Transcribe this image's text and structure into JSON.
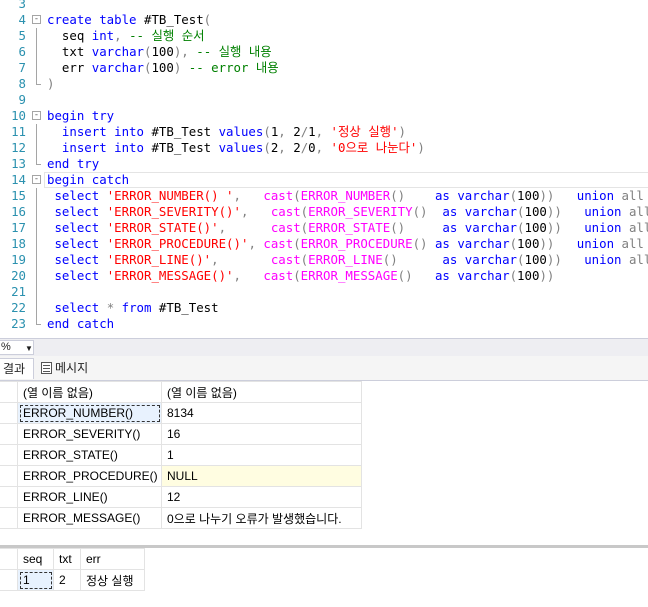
{
  "editor": {
    "lines": [
      {
        "n": "3",
        "fold": "",
        "guide": "",
        "tokens": []
      },
      {
        "n": "4",
        "fold": "-",
        "guide": "",
        "tokens": [
          {
            "c": "kw",
            "t": "create table "
          },
          {
            "c": "tx",
            "t": "#TB_Test"
          },
          {
            "c": "op",
            "t": "("
          }
        ]
      },
      {
        "n": "5",
        "fold": "",
        "guide": "v",
        "tokens": [
          {
            "c": "tx",
            "t": "  seq "
          },
          {
            "c": "kw",
            "t": "int"
          },
          {
            "c": "op",
            "t": ", "
          },
          {
            "c": "cm",
            "t": "-- 실행 순서"
          }
        ]
      },
      {
        "n": "6",
        "fold": "",
        "guide": "v",
        "tokens": [
          {
            "c": "tx",
            "t": "  txt "
          },
          {
            "c": "kw",
            "t": "varchar"
          },
          {
            "c": "op",
            "t": "("
          },
          {
            "c": "tx",
            "t": "100"
          },
          {
            "c": "op",
            "t": "), "
          },
          {
            "c": "cm",
            "t": "-- 실행 내용"
          }
        ]
      },
      {
        "n": "7",
        "fold": "",
        "guide": "v",
        "tokens": [
          {
            "c": "tx",
            "t": "  err "
          },
          {
            "c": "kw",
            "t": "varchar"
          },
          {
            "c": "op",
            "t": "("
          },
          {
            "c": "tx",
            "t": "100"
          },
          {
            "c": "op",
            "t": ") "
          },
          {
            "c": "cm",
            "t": "-- error 내용"
          }
        ]
      },
      {
        "n": "8",
        "fold": "",
        "guide": "end",
        "tokens": [
          {
            "c": "op",
            "t": ")"
          }
        ]
      },
      {
        "n": "9",
        "fold": "",
        "guide": "",
        "tokens": []
      },
      {
        "n": "10",
        "fold": "-",
        "guide": "",
        "tokens": [
          {
            "c": "kw",
            "t": "begin try"
          }
        ]
      },
      {
        "n": "11",
        "fold": "",
        "guide": "v",
        "tokens": [
          {
            "c": "tx",
            "t": "  "
          },
          {
            "c": "kw",
            "t": "insert into "
          },
          {
            "c": "tx",
            "t": "#TB_Test "
          },
          {
            "c": "kw",
            "t": "values"
          },
          {
            "c": "op",
            "t": "("
          },
          {
            "c": "tx",
            "t": "1"
          },
          {
            "c": "op",
            "t": ", "
          },
          {
            "c": "tx",
            "t": "2"
          },
          {
            "c": "op",
            "t": "/"
          },
          {
            "c": "tx",
            "t": "1"
          },
          {
            "c": "op",
            "t": ", "
          },
          {
            "c": "str",
            "t": "'정상 실행'"
          },
          {
            "c": "op",
            "t": ")"
          }
        ]
      },
      {
        "n": "12",
        "fold": "",
        "guide": "v",
        "tokens": [
          {
            "c": "tx",
            "t": "  "
          },
          {
            "c": "kw",
            "t": "insert into "
          },
          {
            "c": "tx",
            "t": "#TB_Test "
          },
          {
            "c": "kw",
            "t": "values"
          },
          {
            "c": "op",
            "t": "("
          },
          {
            "c": "tx",
            "t": "2"
          },
          {
            "c": "op",
            "t": ", "
          },
          {
            "c": "tx",
            "t": "2"
          },
          {
            "c": "op",
            "t": "/"
          },
          {
            "c": "tx",
            "t": "0"
          },
          {
            "c": "op",
            "t": ", "
          },
          {
            "c": "str",
            "t": "'0으로 나눈다'"
          },
          {
            "c": "op",
            "t": ")"
          }
        ]
      },
      {
        "n": "13",
        "fold": "",
        "guide": "end",
        "tokens": [
          {
            "c": "kw",
            "t": "end try"
          }
        ]
      },
      {
        "n": "14",
        "fold": "-",
        "guide": "",
        "current": true,
        "tokens": [
          {
            "c": "kw",
            "t": "begin catch"
          }
        ]
      },
      {
        "n": "15",
        "fold": "",
        "guide": "v",
        "tokens": [
          {
            "c": "tx",
            "t": " "
          },
          {
            "c": "kw",
            "t": "select "
          },
          {
            "c": "str",
            "t": "'ERROR_NUMBER() '"
          },
          {
            "c": "op",
            "t": ",   "
          },
          {
            "c": "fn",
            "t": "cast"
          },
          {
            "c": "op",
            "t": "("
          },
          {
            "c": "fn",
            "t": "ERROR_NUMBER"
          },
          {
            "c": "op",
            "t": "()    "
          },
          {
            "c": "kw",
            "t": "as varchar"
          },
          {
            "c": "op",
            "t": "("
          },
          {
            "c": "tx",
            "t": "100"
          },
          {
            "c": "op",
            "t": "))   "
          },
          {
            "c": "kw",
            "t": "union "
          },
          {
            "c": "op",
            "t": "all"
          }
        ]
      },
      {
        "n": "16",
        "fold": "",
        "guide": "v",
        "tokens": [
          {
            "c": "tx",
            "t": " "
          },
          {
            "c": "kw",
            "t": "select "
          },
          {
            "c": "str",
            "t": "'ERROR_SEVERITY()'"
          },
          {
            "c": "op",
            "t": ",   "
          },
          {
            "c": "fn",
            "t": "cast"
          },
          {
            "c": "op",
            "t": "("
          },
          {
            "c": "fn",
            "t": "ERROR_SEVERITY"
          },
          {
            "c": "op",
            "t": "()  "
          },
          {
            "c": "kw",
            "t": "as varchar"
          },
          {
            "c": "op",
            "t": "("
          },
          {
            "c": "tx",
            "t": "100"
          },
          {
            "c": "op",
            "t": "))   "
          },
          {
            "c": "kw",
            "t": "union "
          },
          {
            "c": "op",
            "t": "all"
          }
        ]
      },
      {
        "n": "17",
        "fold": "",
        "guide": "v",
        "tokens": [
          {
            "c": "tx",
            "t": " "
          },
          {
            "c": "kw",
            "t": "select "
          },
          {
            "c": "str",
            "t": "'ERROR_STATE()'"
          },
          {
            "c": "op",
            "t": ",      "
          },
          {
            "c": "fn",
            "t": "cast"
          },
          {
            "c": "op",
            "t": "("
          },
          {
            "c": "fn",
            "t": "ERROR_STATE"
          },
          {
            "c": "op",
            "t": "()     "
          },
          {
            "c": "kw",
            "t": "as varchar"
          },
          {
            "c": "op",
            "t": "("
          },
          {
            "c": "tx",
            "t": "100"
          },
          {
            "c": "op",
            "t": "))   "
          },
          {
            "c": "kw",
            "t": "union "
          },
          {
            "c": "op",
            "t": "all"
          }
        ]
      },
      {
        "n": "18",
        "fold": "",
        "guide": "v",
        "tokens": [
          {
            "c": "tx",
            "t": " "
          },
          {
            "c": "kw",
            "t": "select "
          },
          {
            "c": "str",
            "t": "'ERROR_PROCEDURE()'"
          },
          {
            "c": "op",
            "t": ", "
          },
          {
            "c": "fn",
            "t": "cast"
          },
          {
            "c": "op",
            "t": "("
          },
          {
            "c": "fn",
            "t": "ERROR_PROCEDURE"
          },
          {
            "c": "op",
            "t": "() "
          },
          {
            "c": "kw",
            "t": "as varchar"
          },
          {
            "c": "op",
            "t": "("
          },
          {
            "c": "tx",
            "t": "100"
          },
          {
            "c": "op",
            "t": "))   "
          },
          {
            "c": "kw",
            "t": "union "
          },
          {
            "c": "op",
            "t": "all"
          }
        ]
      },
      {
        "n": "19",
        "fold": "",
        "guide": "v",
        "tokens": [
          {
            "c": "tx",
            "t": " "
          },
          {
            "c": "kw",
            "t": "select "
          },
          {
            "c": "str",
            "t": "'ERROR_LINE()'"
          },
          {
            "c": "op",
            "t": ",       "
          },
          {
            "c": "fn",
            "t": "cast"
          },
          {
            "c": "op",
            "t": "("
          },
          {
            "c": "fn",
            "t": "ERROR_LINE"
          },
          {
            "c": "op",
            "t": "()      "
          },
          {
            "c": "kw",
            "t": "as varchar"
          },
          {
            "c": "op",
            "t": "("
          },
          {
            "c": "tx",
            "t": "100"
          },
          {
            "c": "op",
            "t": "))   "
          },
          {
            "c": "kw",
            "t": "union "
          },
          {
            "c": "op",
            "t": "all"
          }
        ]
      },
      {
        "n": "20",
        "fold": "",
        "guide": "v",
        "tokens": [
          {
            "c": "tx",
            "t": " "
          },
          {
            "c": "kw",
            "t": "select "
          },
          {
            "c": "str",
            "t": "'ERROR_MESSAGE()'"
          },
          {
            "c": "op",
            "t": ",   "
          },
          {
            "c": "fn",
            "t": "cast"
          },
          {
            "c": "op",
            "t": "("
          },
          {
            "c": "fn",
            "t": "ERROR_MESSAGE"
          },
          {
            "c": "op",
            "t": "()   "
          },
          {
            "c": "kw",
            "t": "as varchar"
          },
          {
            "c": "op",
            "t": "("
          },
          {
            "c": "tx",
            "t": "100"
          },
          {
            "c": "op",
            "t": "))"
          }
        ]
      },
      {
        "n": "21",
        "fold": "",
        "guide": "v",
        "tokens": []
      },
      {
        "n": "22",
        "fold": "",
        "guide": "v",
        "tokens": [
          {
            "c": "tx",
            "t": " "
          },
          {
            "c": "kw",
            "t": "select "
          },
          {
            "c": "op",
            "t": "* "
          },
          {
            "c": "kw",
            "t": "from "
          },
          {
            "c": "tx",
            "t": "#TB_Test"
          }
        ]
      },
      {
        "n": "23",
        "fold": "",
        "guide": "end",
        "tokens": [
          {
            "c": "kw",
            "t": "end catch"
          }
        ]
      }
    ]
  },
  "zoom": {
    "label": "%"
  },
  "tabs": {
    "results": "결과",
    "messages": "메시지"
  },
  "grid1": {
    "headers": [
      "(열 이름 없음)",
      "(열 이름 없음)"
    ],
    "rows": [
      [
        "ERROR_NUMBER()",
        "8134"
      ],
      [
        "ERROR_SEVERITY()",
        "16"
      ],
      [
        "ERROR_STATE()",
        "1"
      ],
      [
        "ERROR_PROCEDURE()",
        "NULL"
      ],
      [
        "ERROR_LINE()",
        "12"
      ],
      [
        "ERROR_MESSAGE()",
        "0으로 나누기 오류가 발생했습니다."
      ]
    ]
  },
  "grid2": {
    "headers": [
      "seq",
      "txt",
      "err"
    ],
    "rows": [
      [
        "1",
        "2",
        "정상 실행"
      ]
    ]
  }
}
